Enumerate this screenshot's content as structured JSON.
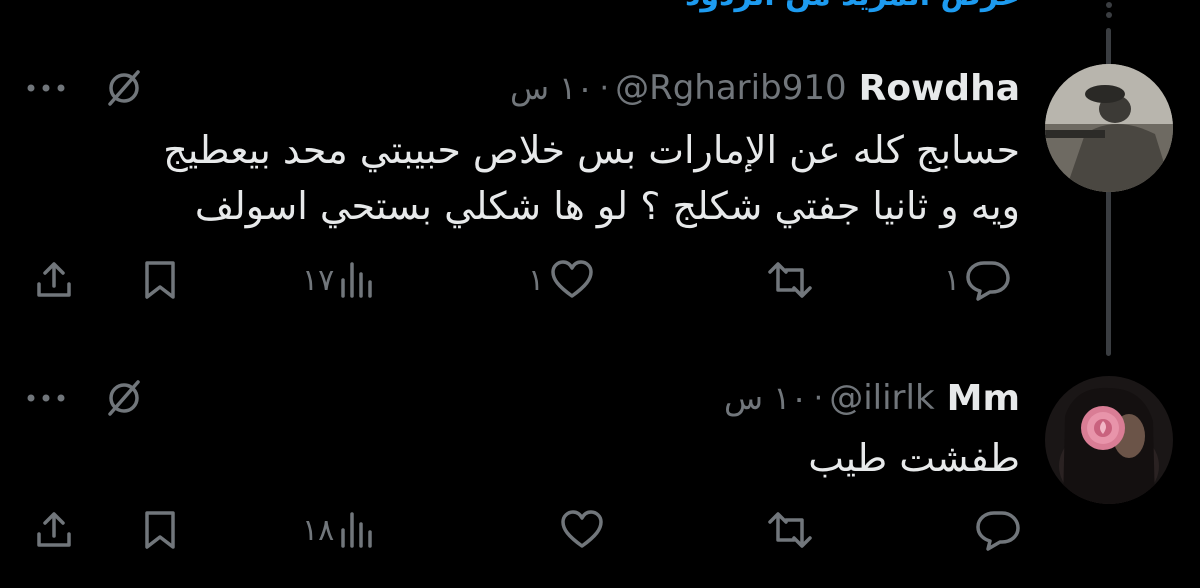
{
  "thread": {
    "show_more_label": "عرض المزيد من الردود"
  },
  "tweets": [
    {
      "name": "Rowdha",
      "handle": "@Rgharib910",
      "separator": "·",
      "time": "١٠ س",
      "text_lines": [
        "حسابج كله عن الإمارات بس خلاص حبيبتي محد بيعطيج",
        "ويه و ثانيا جفتي شكلج ؟ لو ها شكلي بستحي اسولف"
      ],
      "counts": {
        "replies": "١",
        "retweets": "",
        "likes": "١",
        "views": "١٧"
      },
      "avatar_icon": "profile-photo"
    },
    {
      "name": "Mm",
      "handle": "@ilirlk",
      "separator": "·",
      "time": "١٠ س",
      "text_lines": [
        "طفشت طيب"
      ],
      "counts": {
        "replies": "",
        "retweets": "",
        "likes": "",
        "views": "١٨"
      },
      "avatar_icon": "rose-profile-photo"
    }
  ],
  "colors": {
    "background": "#000000",
    "text": "#e7e9ea",
    "secondary": "#71767b",
    "link": "#1d9bf0",
    "thread_line": "#3a3d41"
  }
}
